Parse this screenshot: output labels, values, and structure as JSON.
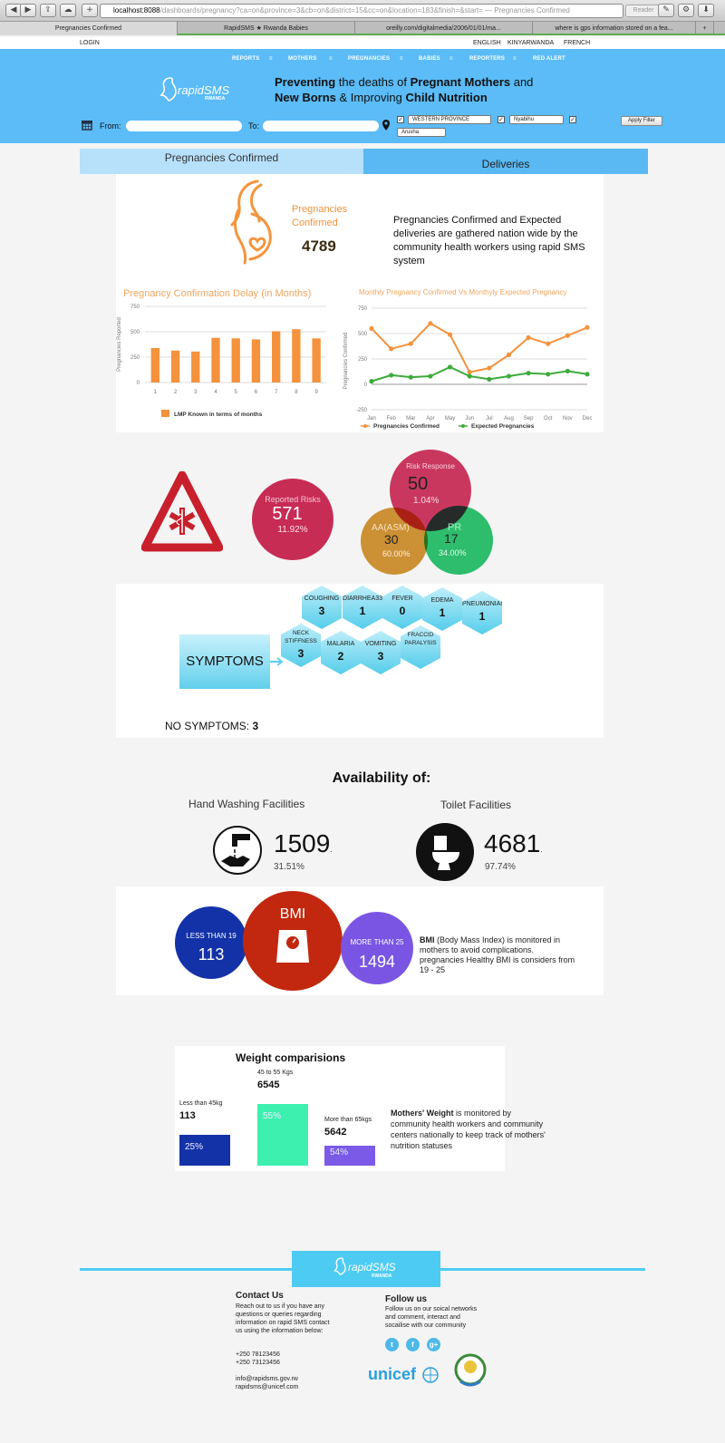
{
  "browser": {
    "url_host": "localhost:8088",
    "url_path": "/dashboards/pregnancy?ca=on&province=3&cb=on&district=15&cc=on&location=183&finish=&start= — Pregnancies Confirmed",
    "reader": "Reader",
    "tabs": [
      "Pregnancies Confirmed",
      "RapidSMS ★ Rwanda Babies",
      "oreilly.com/digitalmedia/2006/01/01/ma...",
      "where is gps information stored on a fea...",
      "+"
    ]
  },
  "topbar": {
    "login": "LOGIN",
    "languages": [
      "ENGLISH",
      "KINYARWANDA",
      "FRENCH"
    ]
  },
  "nav": [
    "REPORTS",
    "MOTHERS",
    "PREGNANCIES",
    "BABIES",
    "REPORTERS",
    "RED ALERT"
  ],
  "nav_sep": "≡",
  "logo": {
    "text": "rapidSMS",
    "sub": "RWANDA"
  },
  "tagline": {
    "p1": "Preventing",
    "p2": " the deaths of ",
    "p3": "Pregnant Mothers",
    "p4": " and ",
    "p5": "New Borns",
    "p6": " & Improving ",
    "p7": "Child Nutrition"
  },
  "filter": {
    "from_label": "From:",
    "to_label": "To:",
    "province": "WESTERN PROVINCE",
    "district": "Nyabihu",
    "location": "Arusha",
    "apply": "Apply Filter",
    "check": "✓"
  },
  "tabs": {
    "confirmed": "Pregnancies Confirmed",
    "deliveries": "Deliveries"
  },
  "summary": {
    "label_l1": "Pregnancies",
    "label_l2": "Confirmed",
    "value": "4789",
    "description": "Pregnancies Confirmed and Expected deliveries are gathered nation wide by the community health workers using rapid SMS system"
  },
  "chart_data": [
    {
      "type": "bar",
      "title": "Pregnancy Confirmation Delay (in Months)",
      "ylabel": "Pregnancies Reported",
      "xlabel": "",
      "categories": [
        "1",
        "2",
        "3",
        "4",
        "5",
        "6",
        "7",
        "8",
        "9"
      ],
      "values": [
        340,
        315,
        305,
        440,
        435,
        425,
        505,
        525,
        435
      ],
      "ylim": [
        0,
        750
      ],
      "yticks": [
        "0",
        "250",
        "500",
        "750"
      ],
      "color": "#f5923e",
      "legend": "LMP Known in terms of months",
      "legend_position": "bottom",
      "grid": true
    },
    {
      "type": "line",
      "title": "Monthly Pregnancy Confirmed Vs Monthyly Expected Pregnancy",
      "ylabel": "Pregnancies Confirmed",
      "xlabel": "",
      "categories": [
        "Jan",
        "Feb",
        "Mar",
        "Apr",
        "May",
        "Jun",
        "Jul",
        "Aug",
        "Sep",
        "Oct",
        "Nov",
        "Dec"
      ],
      "ylim": [
        -250,
        750
      ],
      "yticks": [
        "-250",
        "0",
        "250",
        "500",
        "750"
      ],
      "series": [
        {
          "name": "Pregnancies Confirmed",
          "color": "#f5923e",
          "values": [
            550,
            350,
            400,
            600,
            490,
            120,
            160,
            290,
            460,
            400,
            480,
            560
          ]
        },
        {
          "name": "Expected Pregnancies",
          "color": "#3dab3a",
          "values": [
            30,
            90,
            70,
            80,
            170,
            80,
            50,
            80,
            110,
            100,
            130,
            100
          ]
        }
      ],
      "legend_position": "bottom",
      "grid": true
    }
  ],
  "risks": {
    "reported": {
      "label": "Reported Risks",
      "value": "571",
      "pct": "11.92%"
    },
    "response": {
      "label": "Risk Response",
      "value": "50",
      "pct": "1.04%"
    },
    "aa": {
      "label": "AA(ASM)",
      "value": "30",
      "pct": "60.00%"
    },
    "pr": {
      "label": "PR",
      "value": "17",
      "pct": "34.00%"
    }
  },
  "symptoms": {
    "label": "SYMPTOMS",
    "items": [
      {
        "name": "COUGHING",
        "count": "3"
      },
      {
        "name": "DIARRHEA33",
        "count": "1"
      },
      {
        "name": "FEVER",
        "count": "0"
      },
      {
        "name": "EDEMA",
        "count": "1"
      },
      {
        "name": "PNEUMONIAM",
        "count": "1"
      },
      {
        "name": "NECK STIFFNESS",
        "count": "3"
      },
      {
        "name": "MALARIA",
        "count": "2"
      },
      {
        "name": "VOMITING",
        "count": "3"
      },
      {
        "name": "FRACCID PARALYSIS",
        "count": ""
      }
    ],
    "no_symptoms_label": "NO SYMPTOMS:",
    "no_symptoms_value": "3"
  },
  "availability": {
    "title": "Availability of:",
    "hand": {
      "label": "Hand Washing Facilities",
      "value": "1509",
      "pct": "31.51%"
    },
    "toilet": {
      "label": "Toilet Facilities",
      "value": "4681",
      "pct": "97.74%"
    },
    "suffix": "."
  },
  "bmi": {
    "title": "BMI",
    "less": {
      "label": "LESS THAN 19",
      "value": "113"
    },
    "more": {
      "label": "MORE THAN 25",
      "value": "1494"
    },
    "desc_bold": "BMI",
    "desc": " (Body Mass Index) is monitored in mothers to avoid complications. pregnancies Healthy BMI is considers from 19 - 25"
  },
  "weight": {
    "title": "Weight comparisions",
    "bars": [
      {
        "label": "Less than 45kg",
        "value": "113",
        "pct": "25%",
        "color": "#1432a8"
      },
      {
        "label": "45 to 55 Kgs",
        "value": "6545",
        "pct": "55%",
        "color": "#3df0b0"
      },
      {
        "label": "More than 65kgs",
        "value": "5642",
        "pct": "54%",
        "color": "#7a5ae6"
      }
    ],
    "desc_bold": "Mothers' Weight",
    "desc": " is monitored by community health workers and community centers nationally to keep track of mothers' nutrition statuses"
  },
  "footer": {
    "contact_title": "Contact Us",
    "contact_text": "Reach out to us if you have any questions or queries regarding information on rapid SMS contact us using the information below:",
    "phones": [
      "+250 78123456",
      "+250 73123456"
    ],
    "emails": [
      "info@rapidsms.gov.rw",
      "rapidsms@unicef.com"
    ],
    "follow_title": "Follow us",
    "follow_text": "Follow us on our soical networks and comment, interact and socailise with our community",
    "social": [
      "t",
      "f",
      "g+"
    ],
    "unicef": "unicef"
  }
}
